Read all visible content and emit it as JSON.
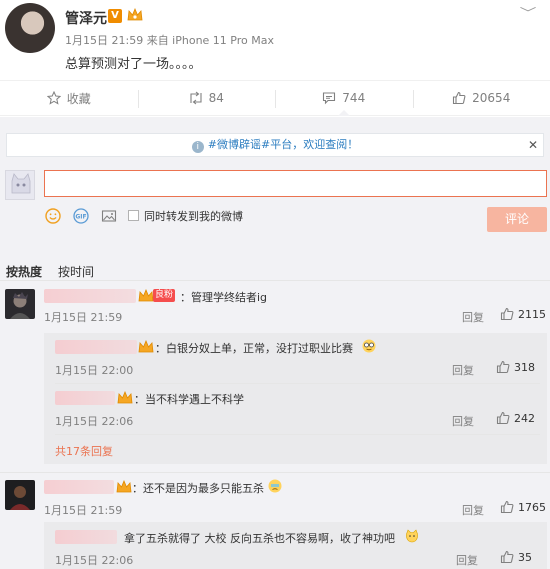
{
  "post": {
    "author": "管泽元",
    "verified_badge": "V",
    "meta": "1月15日 21:59 来自 iPhone 11 Pro Max",
    "text": "总算预测对了一场。。。。"
  },
  "actions": {
    "favorite": "收藏",
    "repost": "84",
    "comments": "744",
    "likes": "20654"
  },
  "comment_box": {
    "notice": "#微博辟谣#平台，欢迎查阅！",
    "placeholder": "",
    "repost_option": "同时转发到我的微博",
    "submit": "评论"
  },
  "sort": {
    "hot": "按热度",
    "time": "按时间"
  },
  "comments": [
    {
      "badge": "良粉",
      "text": "：管理学终结者ig",
      "time": "1月15日 21:59",
      "reply": "回复",
      "likes": "2115",
      "sub": [
        {
          "text": "：白银分奴上单，正常，没打过职业比赛",
          "time": "1月15日 22:00",
          "reply": "回复",
          "likes": "318"
        },
        {
          "text": "：当不科学遇上不科学",
          "time": "1月15日 22:06",
          "reply": "回复",
          "likes": "242"
        }
      ],
      "more": "共17条回复"
    },
    {
      "text": "：还不是因为最多只能五杀",
      "time": "1月15日 21:59",
      "reply": "回复",
      "likes": "1765",
      "sub": [
        {
          "text": "拿了五杀就得了 大校 反向五杀也不容易啊，收了神功吧",
          "time": "1月15日 22:06",
          "reply": "回复",
          "likes": "35"
        }
      ]
    }
  ],
  "colors": {
    "accent": "#eb7350",
    "link": "#eb7350",
    "background": "#f2f2f5"
  }
}
